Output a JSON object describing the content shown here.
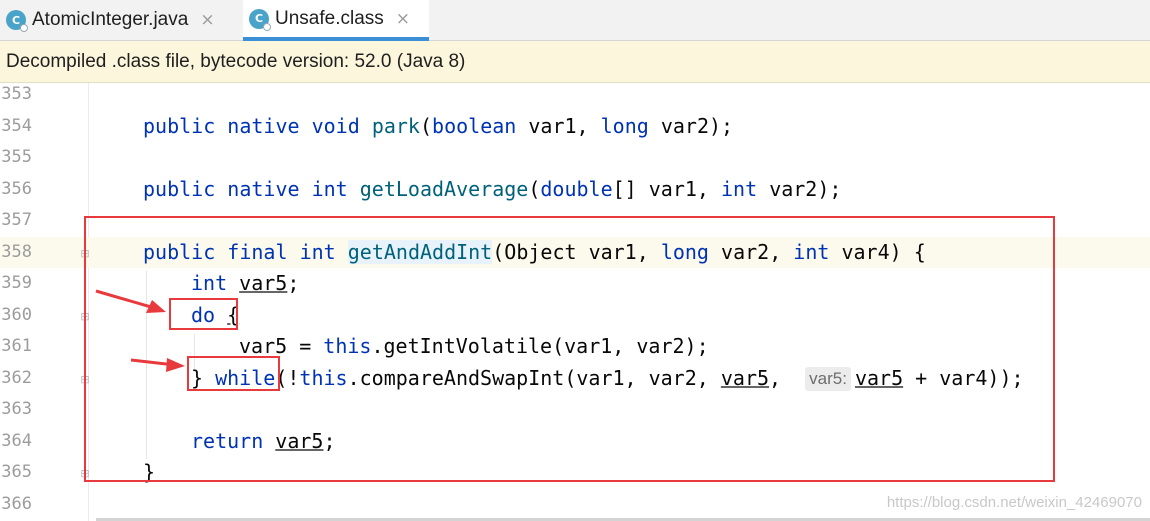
{
  "tabs": [
    {
      "label": "AtomicInteger.java",
      "icon": "java-class-icon",
      "active": false
    },
    {
      "label": "Unsafe.class",
      "icon": "java-class-icon",
      "active": true
    }
  ],
  "icon_letter": "C",
  "close_glyph": "×",
  "banner": {
    "text": "Decompiled .class file, bytecode version: 52.0 (Java 8)"
  },
  "editor": {
    "line_numbers": [
      "353",
      "354",
      "355",
      "356",
      "357",
      "358",
      "359",
      "360",
      "361",
      "362",
      "363",
      "364",
      "365",
      "366"
    ],
    "code": {
      "l354": [
        "public",
        "native",
        "void",
        "park",
        "(",
        "boolean",
        "var1, ",
        "long",
        "var2);"
      ],
      "l356": [
        "public",
        "native",
        "int",
        "getLoadAverage",
        "(",
        "double",
        "[] var1, ",
        "int",
        "var2);"
      ],
      "l358": [
        "public",
        "final",
        "int",
        "getAndAddInt",
        "(Object var1, ",
        "long",
        "var2, ",
        "int",
        "var4) {"
      ],
      "l359": [
        "int",
        "var5",
        ";"
      ],
      "l360": [
        "do",
        "{"
      ],
      "l361": [
        "var5",
        " = ",
        "this",
        ".getIntVolatile(var1, var2);"
      ],
      "l362": [
        "} ",
        "while",
        "(!",
        "this",
        ".compareAndSwapInt(var1, var2, ",
        "var5",
        ", ",
        "var5:",
        "var5",
        " + var4));"
      ],
      "l364": [
        "return",
        "var5",
        ";"
      ],
      "l365": [
        "}"
      ]
    }
  },
  "watermark": "https://blog.csdn.net/weixin_42469070",
  "colors": {
    "keyword": "#0033b3",
    "method": "#00627a",
    "annotation_red": "#e8393c",
    "banner_bg": "#fbf6dc"
  }
}
